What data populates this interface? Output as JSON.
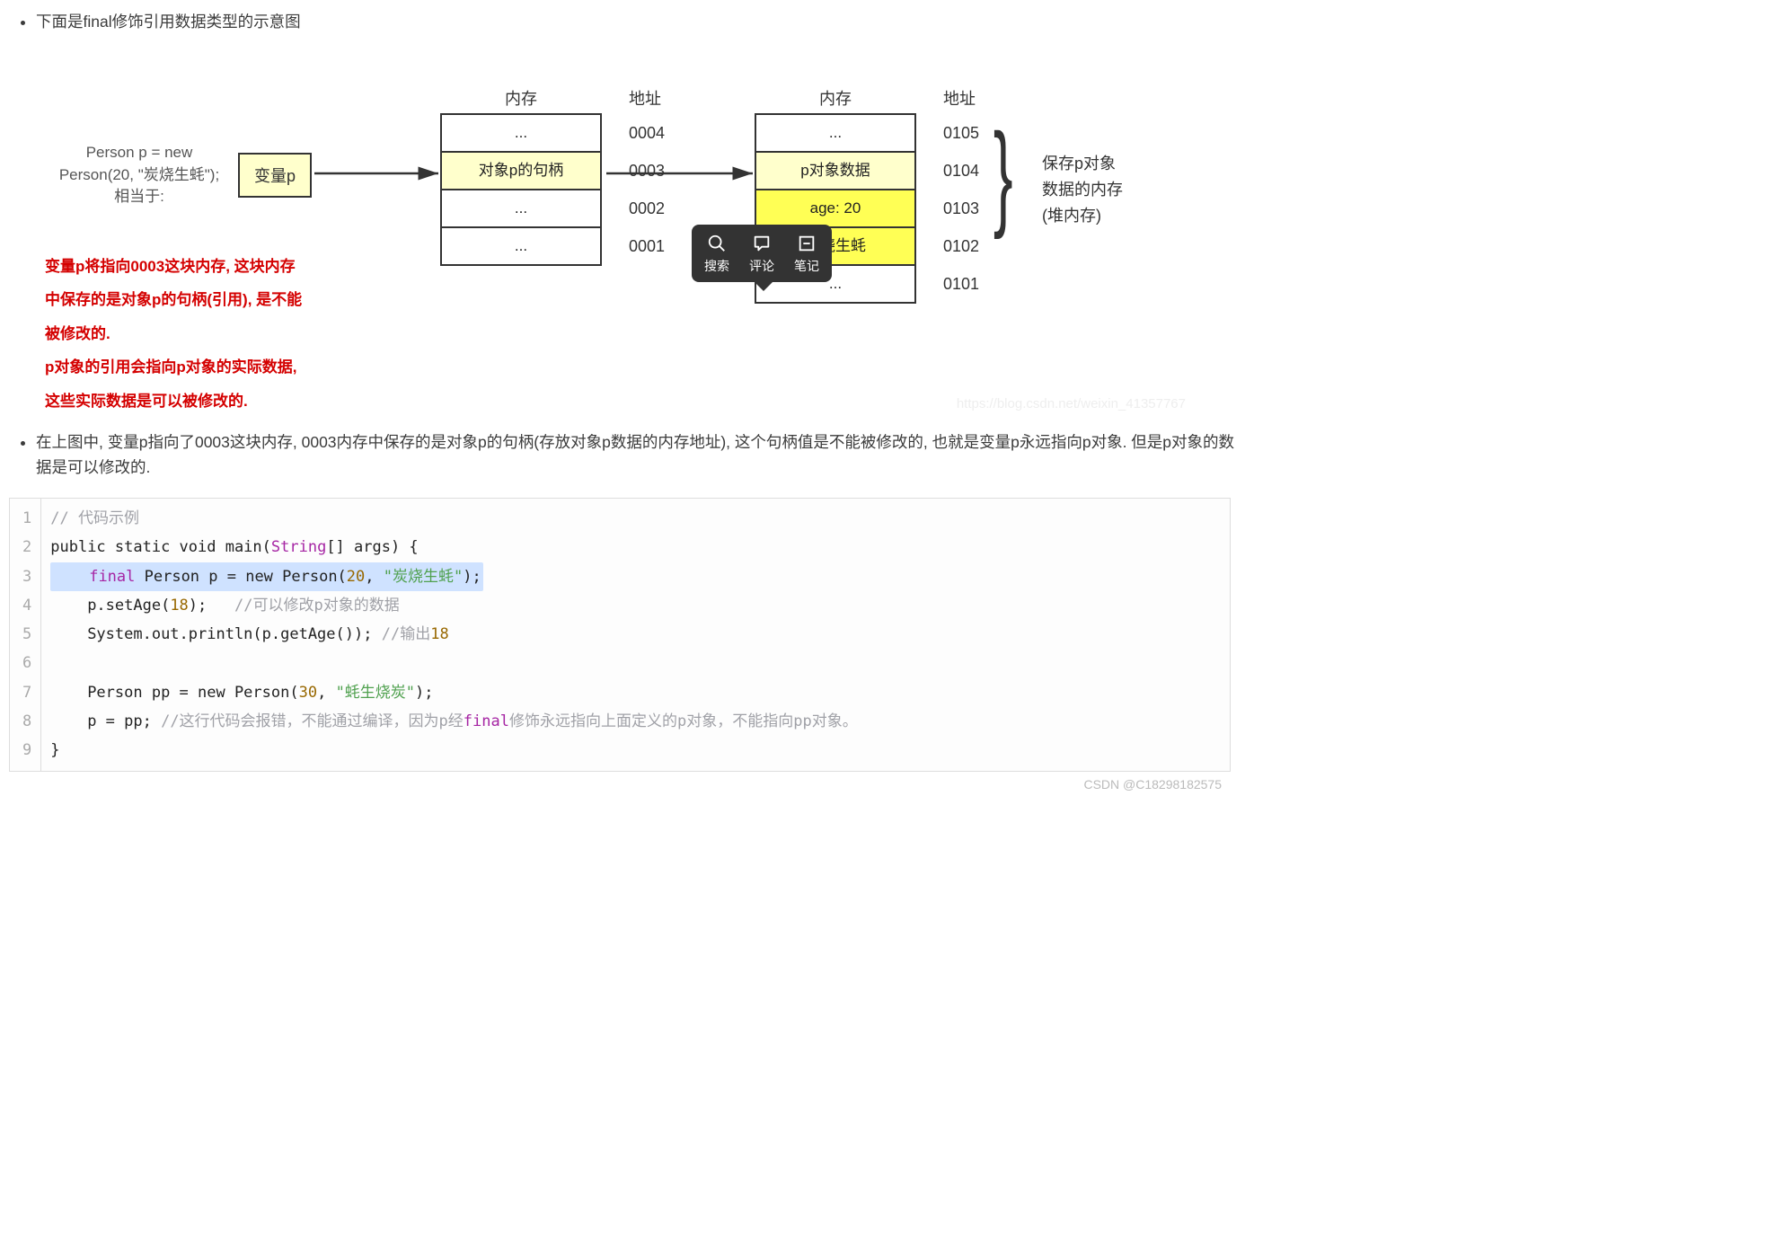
{
  "bullets": {
    "b1": "下面是final修饰引用数据类型的示意图",
    "b2": "在上图中, 变量p指向了0003这块内存, 0003内存中保存的是对象p的句柄(存放对象p数据的内存地址), 这个句柄值是不能被修改的, 也就是变量p永远指向p对象. 但是p对象的数据是可以修改的."
  },
  "diagram": {
    "left_decl_1": "Person p = new",
    "left_decl_2": "Person(20, \"炭烧生蚝\");",
    "left_decl_3": "相当于:",
    "var_box": "变量p",
    "mem_header": "内存",
    "addr_header": "地址",
    "col1": {
      "cells": [
        "...",
        "对象p的句柄",
        "...",
        "..."
      ],
      "addrs": [
        "0004",
        "0003",
        "0002",
        "0001"
      ]
    },
    "col2": {
      "cells": [
        "...",
        "p对象数据",
        "age: 20",
        "炭烧生蚝",
        "..."
      ],
      "addrs": [
        "0105",
        "0104",
        "0103",
        "0102",
        "0101"
      ]
    },
    "brace_label_1": "保存p对象",
    "brace_label_2": "数据的内存",
    "brace_label_3": "(堆内存)",
    "red_l1": "变量p将指向0003这块内存, 这块内存",
    "red_l2": "中保存的是对象p的句柄(引用), 是不能",
    "red_l3": "被修改的.",
    "red_l4": "p对象的引用会指向p对象的实际数据,",
    "red_l5": "这些实际数据是可以被修改的.",
    "watermark": "https://blog.csdn.net/weixin_41357767"
  },
  "popover": {
    "search": "搜索",
    "comment": "评论",
    "note": "笔记"
  },
  "code": {
    "l1_cmt": "// 代码示例",
    "l2": "public static void main(",
    "l2_type": "String",
    "l2b": "[] args) {",
    "l3_sp": "    ",
    "l3_final": "final",
    "l3a": " Person p = new Person(",
    "l3_num1": "20",
    "l3_comma": ", ",
    "l3_str": "\"炭烧生蚝\"",
    "l3_end": ");",
    "l4": "    p.setAge(",
    "l4_num": "18",
    "l4b": ");   ",
    "l4_cmt": "//可以修改p对象的数据",
    "l5": "    System.out.println(p.getAge()); ",
    "l5_cmt": "//输出",
    "l5_num": "18",
    "l7": "    Person pp = new Person(",
    "l7_num": "30",
    "l7_comma": ", ",
    "l7_str": "\"蚝生烧炭\"",
    "l7_end": ");",
    "l8": "    p = pp; ",
    "l8_cmt1": "//这行代码会报错，不能通过编译，因为p经",
    "l8_final": "final",
    "l8_cmt2": "修饰永远指向上面定义的p对象，不能指向pp对象。",
    "l9": "}"
  },
  "footer_watermark": "CSDN @C18298182575"
}
